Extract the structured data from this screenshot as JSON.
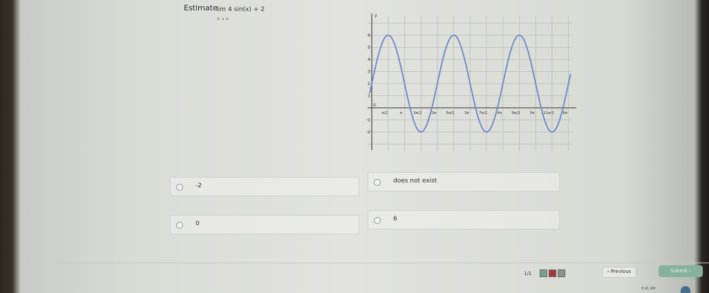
{
  "question": {
    "prompt_label": "Estimate",
    "limit_word": "lim",
    "limit_sub": "x → ∞",
    "limit_expression": "4 sin(x) + 2"
  },
  "graph": {
    "y_axis_label": "y",
    "y_ticks": [
      "6",
      "5",
      "4",
      "3",
      "2",
      "1",
      "-1",
      "-2"
    ],
    "x_ticks": [
      "0",
      "π/2",
      "π",
      "3π/2",
      "2π",
      "5π/2",
      "3π",
      "7π/2",
      "4π",
      "9π/2",
      "5π",
      "11π/2",
      "6π"
    ],
    "curve_color": "#6a85c8"
  },
  "chart_data": {
    "type": "line",
    "function": "4 sin(x) + 2",
    "x": [
      0,
      0.7854,
      1.5708,
      2.3562,
      3.1416,
      3.927,
      4.7124,
      5.4978,
      6.2832,
      7.0686,
      7.854,
      8.6394,
      9.4248,
      10.2102,
      10.9956,
      11.781,
      12.5664,
      13.3518,
      14.1372,
      14.9226,
      15.708,
      16.4934,
      17.2788,
      18.0642,
      18.8496
    ],
    "y": [
      2,
      4.83,
      6,
      4.83,
      2,
      -0.83,
      -2,
      -0.83,
      2,
      4.83,
      6,
      4.83,
      2,
      -0.83,
      -2,
      -0.83,
      2,
      4.83,
      6,
      4.83,
      2,
      -0.83,
      -2,
      -0.83,
      2
    ],
    "x_tick_labels": [
      "0",
      "π/2",
      "π",
      "3π/2",
      "2π",
      "5π/2",
      "3π",
      "7π/2",
      "4π",
      "9π/2",
      "5π",
      "11π/2",
      "6π"
    ],
    "y_tick_labels": [
      "-2",
      "-1",
      "1",
      "2",
      "3",
      "4",
      "5",
      "6"
    ],
    "xlim": [
      -0.5,
      19.0
    ],
    "ylim": [
      -3,
      7
    ],
    "ylabel": "y",
    "grid": true
  },
  "options": [
    {
      "label": "-2"
    },
    {
      "label": "does not exist"
    },
    {
      "label": "0"
    },
    {
      "label": "6"
    }
  ],
  "footer": {
    "page_indicator": "1/1",
    "previous_label": "‹  Previous",
    "submit_label": "Submit  ›",
    "clock": "8:41 AM",
    "square_colors": [
      "#7aa18a",
      "#a33b3b",
      "#8e918b"
    ]
  }
}
